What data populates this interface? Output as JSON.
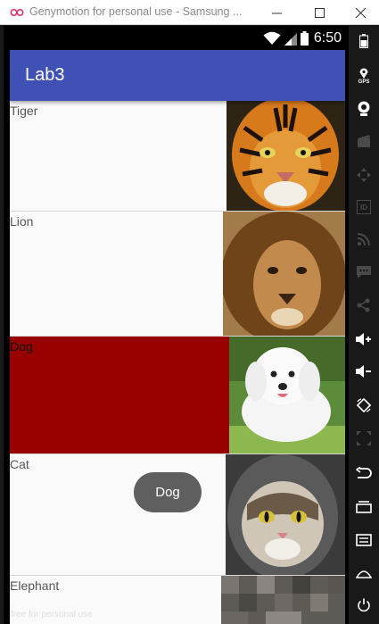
{
  "window": {
    "title": "Genymotion for personal use - Samsung ...",
    "minimize_label": "minimize",
    "maximize_label": "maximize",
    "close_label": "close"
  },
  "status_bar": {
    "time": "6:50",
    "icons": [
      "wifi-icon",
      "signal-icon",
      "battery-icon"
    ]
  },
  "app": {
    "title": "Lab3",
    "toolbar_color": "#3f51b5",
    "selected_color": "#980000"
  },
  "list": {
    "items": [
      {
        "label": "Tiger",
        "selected": false,
        "image": "tiger-image"
      },
      {
        "label": "Lion",
        "selected": false,
        "image": "lion-image"
      },
      {
        "label": "Dog",
        "selected": true,
        "image": "dog-image"
      },
      {
        "label": "Cat",
        "selected": false,
        "image": "cat-image"
      },
      {
        "label": "Elephant",
        "selected": false,
        "image": "elephant-image"
      }
    ]
  },
  "toast": {
    "text": "Dog"
  },
  "sidebar": {
    "buttons": [
      "battery-icon",
      "gps-icon",
      "webcam-icon",
      "media-icon",
      "move-icon",
      "id-icon",
      "rss-icon",
      "sms-icon",
      "share-icon",
      "volume-up-icon",
      "volume-down-icon",
      "rotate-icon",
      "scale-icon",
      "back-icon",
      "recent-apps-icon",
      "menu-icon",
      "home-icon",
      "power-icon"
    ],
    "gps_label": "GPS",
    "id_label": "ID"
  },
  "watermark": {
    "text": "free for personal use"
  }
}
